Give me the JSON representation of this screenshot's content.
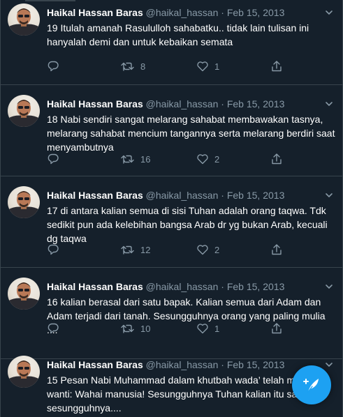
{
  "tweets": [
    {
      "name": "Haikal Hassan Baras",
      "handle": "@haikal_hassan",
      "sep": "·",
      "date": "Feb 15, 2013",
      "text": "19 Itulah amanah Rasululloh sahabatku.. tidak lain tulisan ini hanyalah demi dan untuk kebaikan semata",
      "reply_count": "",
      "retweet_count": "8",
      "like_count": "1"
    },
    {
      "name": "Haikal Hassan Baras",
      "handle": "@haikal_hassan",
      "sep": "·",
      "date": "Feb 15, 2013",
      "text": "18 Nabi sendiri sangat melarang sahabat membawakan tasnya, melarang sahabat mencium tangannya serta melarang berdiri saat menyambutnya",
      "reply_count": "",
      "retweet_count": "16",
      "like_count": "2"
    },
    {
      "name": "Haikal Hassan Baras",
      "handle": "@haikal_hassan",
      "sep": "·",
      "date": "Feb 15, 2013",
      "text": "17 di antara kalian semua di sisi Tuhan adalah orang taqwa. Tdk sedikit pun ada kelebihan bangsa Arab dr yg bukan Arab, kecuali dg taqwa",
      "reply_count": "",
      "retweet_count": "12",
      "like_count": "2"
    },
    {
      "name": "Haikal Hassan Baras",
      "handle": "@haikal_hassan",
      "sep": "·",
      "date": "Feb 15, 2013",
      "text": "16 kalian berasal dari satu bapak. Kalian semua dari Adam dan Adam terjadi dari tanah. Sesungguhnya orang yang paling mulia ....",
      "reply_count": "",
      "retweet_count": "10",
      "like_count": "1"
    },
    {
      "name": "Haikal Hassan Baras",
      "handle": "@haikal_hassan",
      "sep": "·",
      "date": "Feb 15, 2013",
      "text": "15 Pesan Nabi Muhammad dalam khutbah wada’ telah me wanti: Wahai manusia! Sesungguhnya Tuhan kalian itu sat sesungguhnya....",
      "reply_count": "",
      "retweet_count": "",
      "like_count": ""
    }
  ],
  "icons": {
    "reply": "reply-icon",
    "retweet": "retweet-icon",
    "like": "heart-icon",
    "share": "share-icon",
    "more": "chevron-down-icon",
    "compose": "compose-tweet-icon"
  },
  "colors": {
    "background": "#15202b",
    "divider": "#38444d",
    "text_primary": "#ffffff",
    "text_secondary": "#8899a6",
    "accent": "#1da1f2"
  }
}
